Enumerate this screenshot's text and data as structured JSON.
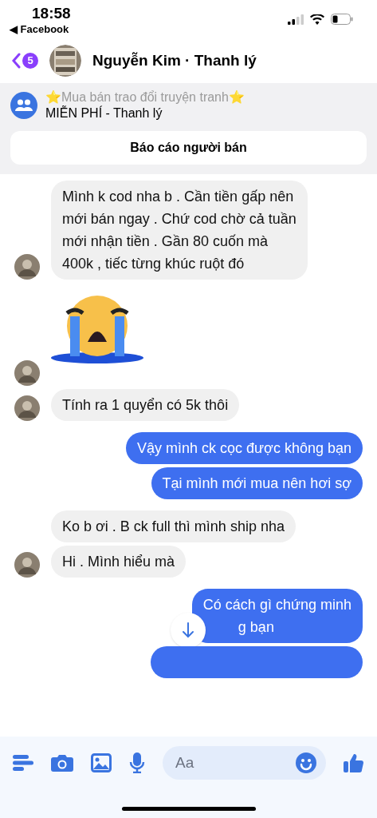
{
  "status_bar": {
    "time": "18:58",
    "back_app": "◀ Facebook"
  },
  "header": {
    "unread_count": "5",
    "title": "Nguyễn Kim · Thanh lý"
  },
  "group": {
    "name": "⭐Mua bán trao đổi truyện tranh⭐",
    "subtitle": "MIỄN PHÍ - Thanh lý",
    "report_button": "Báo cáo người bán"
  },
  "messages": [
    {
      "kind": "text",
      "outgoing": false,
      "avatar": true,
      "lines": [
        "Mình k cod nha b . Cần tiền gấp nên mới bán ngay . Chứ cod chờ cả tuần mới nhận tiền . Gần 80 cuốn mà 400k , tiếc từng khúc ruột đó"
      ]
    },
    {
      "kind": "emoji",
      "outgoing": false,
      "avatar": true
    },
    {
      "kind": "text",
      "outgoing": false,
      "avatar": true,
      "lines": [
        "Tính ra 1 quyển có 5k thôi"
      ]
    },
    {
      "kind": "text",
      "outgoing": true,
      "lines": [
        "Vậy mình ck cọc được không bạn"
      ]
    },
    {
      "kind": "text",
      "outgoing": true,
      "lines": [
        "Tại mình mới mua nên hơi sợ"
      ]
    },
    {
      "kind": "text",
      "outgoing": false,
      "avatar": false,
      "lines": [
        "Ko b ơi . B ck full thì mình ship nha"
      ]
    },
    {
      "kind": "text",
      "outgoing": false,
      "avatar": true,
      "lines": [
        "Hi . Mình hiểu mà"
      ]
    },
    {
      "kind": "text",
      "outgoing": true,
      "covered": true,
      "lines": [
        "Có cách gì chứng minh",
        "g bạn"
      ]
    },
    {
      "kind": "clipped",
      "outgoing": true
    }
  ],
  "composer": {
    "placeholder": "Aa"
  }
}
